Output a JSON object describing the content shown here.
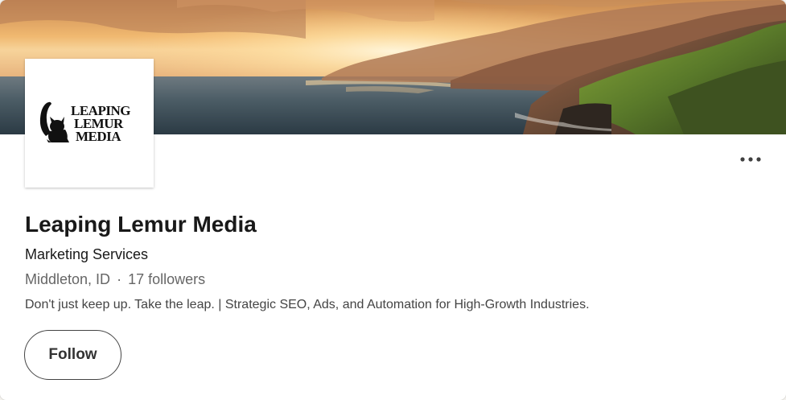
{
  "company": {
    "name": "Leaping Lemur Media",
    "industry": "Marketing Services",
    "location": "Middleton, ID",
    "separator": "·",
    "followers": "17 followers",
    "tagline": "Don't just keep up. Take the leap. | Strategic SEO, Ads, and Automation for High-Growth Industries."
  },
  "logo": {
    "line1": "LEAPING",
    "line2": "LEMUR",
    "line3": "MEDIA"
  },
  "actions": {
    "follow_label": "Follow",
    "more_icon": "more-horizontal-icon"
  },
  "colors": {
    "primary_text": "#191919",
    "secondary_text": "#666666",
    "button_border": "#444444"
  }
}
